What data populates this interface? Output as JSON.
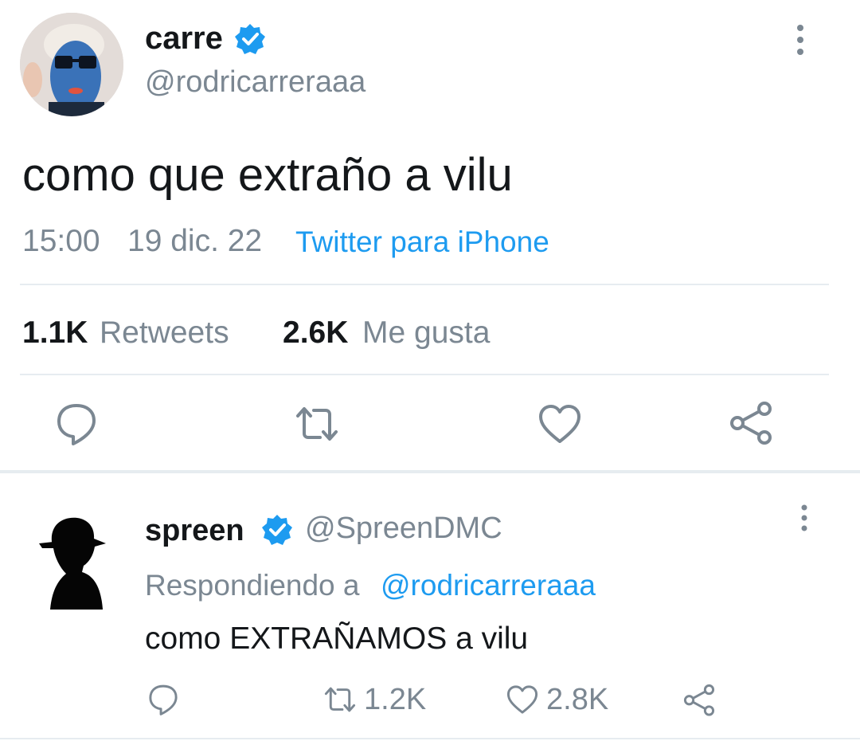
{
  "colors": {
    "accent": "#1d9bf0",
    "muted": "#7b8792",
    "text": "#14171a",
    "divider": "#e6ecf0"
  },
  "main_tweet": {
    "display_name": "carre",
    "handle": "@rodricarreraaa",
    "text": "como que extraño a vilu",
    "time": "15:00",
    "date": "19 dic. 22",
    "source": "Twitter para iPhone",
    "stats": {
      "retweets_count": "1.1K",
      "retweets_label": "Retweets",
      "likes_count": "2.6K",
      "likes_label": "Me gusta"
    },
    "actions": [
      "reply-icon",
      "retweet-icon",
      "like-icon",
      "share-icon"
    ]
  },
  "reply": {
    "display_name": "spreen",
    "handle": "@SpreenDMC",
    "replying_to_label": "Respondiendo a",
    "replying_to_handle": "@rodricarreraaa",
    "text": "como EXTRAÑAMOS a vilu",
    "retweets": "1.2K",
    "likes": "2.8K"
  }
}
